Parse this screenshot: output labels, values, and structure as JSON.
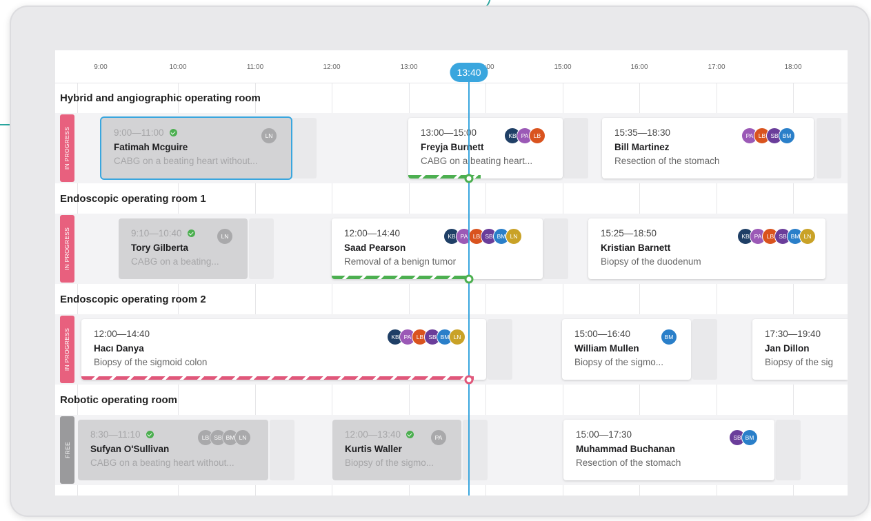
{
  "timeline": {
    "ticks": [
      "9:00",
      "10:00",
      "11:00",
      "12:00",
      "13:00",
      "14:00",
      "15:00",
      "16:00",
      "17:00",
      "18:00"
    ],
    "now_label": "13:40"
  },
  "colors": {
    "now": "#3aa6de",
    "in_progress": "#e8607e",
    "free": "#9a9a9c",
    "on_time": "#4caf50"
  },
  "avatar_colors": {
    "KB": "#1f3f66",
    "PA": "#9b59b6",
    "LB": "#d9531e",
    "SB": "#6a3d9a",
    "BM": "#2a7fc9",
    "LN": "#c9a227"
  },
  "rooms": [
    {
      "title": "Hybrid and angiographic operating room",
      "status": "IN PROGRESS",
      "cards": [
        {
          "time": "9:00—11:00",
          "name": "Fatimah Mcguire",
          "desc": "CABG on a beating heart without...",
          "avatars": [
            "LN"
          ],
          "completed": true
        },
        {
          "time": "13:00—15:00",
          "name": "Freyja Burnett",
          "desc": "CABG on a beating heart...",
          "avatars": [
            "KB",
            "PA",
            "LB"
          ],
          "progress": 0.47
        },
        {
          "time": "15:35—18:30",
          "name": "Bill Martinez",
          "desc": "Resection of the stomach",
          "avatars": [
            "PA",
            "LB",
            "SB",
            "BM"
          ]
        }
      ]
    },
    {
      "title": "Endoscopic operating room 1",
      "status": "IN PROGRESS",
      "cards": [
        {
          "time": "9:10—10:40",
          "name": "Tory Gilberta",
          "desc": "CABG on a beating...",
          "avatars": [
            "LN"
          ],
          "completed": true
        },
        {
          "time": "12:00—14:40",
          "name": "Saad Pearson",
          "desc": "Removal of a benign tumor",
          "avatars": [
            "KB",
            "PA",
            "LB",
            "SB",
            "BM",
            "LN"
          ],
          "progress": 0.65
        },
        {
          "time": "15:25—18:50",
          "name": "Kristian Barnett",
          "desc": "Biopsy of the duodenum",
          "avatars": [
            "KB",
            "PA",
            "LB",
            "SB",
            "BM",
            "LN"
          ]
        }
      ]
    },
    {
      "title": "Endoscopic operating room 2",
      "status": "IN PROGRESS",
      "cards": [
        {
          "time": "12:00—14:40",
          "name": "Hacı Danya",
          "desc": "Biopsy of the sigmoid colon",
          "avatars": [
            "KB",
            "PA",
            "LB",
            "SB",
            "BM",
            "LN"
          ],
          "progress": 0.97
        },
        {
          "time": "15:00—16:40",
          "name": "William Mullen",
          "desc": "Biopsy of the sigmo...",
          "avatars": [
            "BM"
          ]
        },
        {
          "time": "17:30—19:40",
          "name": "Jan Dillon",
          "desc": "Biopsy of the sig",
          "avatars": []
        }
      ]
    },
    {
      "title": "Robotic operating room",
      "status": "FREE",
      "cards": [
        {
          "time": "8:30—11:10",
          "name": "Sufyan O'Sullivan",
          "desc": "CABG on a beating heart without...",
          "avatars": [
            "LB",
            "SB",
            "BM",
            "LN"
          ],
          "completed": true
        },
        {
          "time": "12:00—13:40",
          "name": "Kurtis Waller",
          "desc": "Biopsy of the sigmo...",
          "avatars": [
            "PA"
          ],
          "completed": true
        },
        {
          "time": "15:00—17:30",
          "name": "Muhammad Buchanan",
          "desc": "Resection of the stomach",
          "avatars": [
            "SB",
            "BM"
          ]
        }
      ]
    }
  ]
}
